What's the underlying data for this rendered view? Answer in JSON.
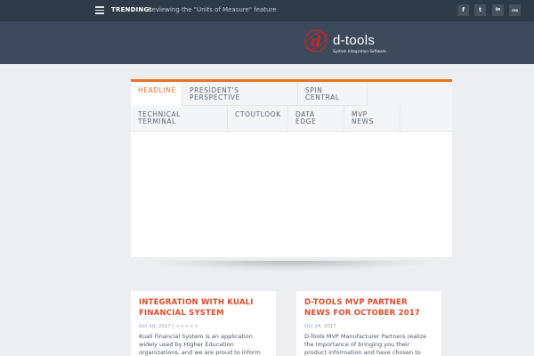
{
  "topbar": {
    "trending_label": "TRENDING:",
    "trending_text": "Reviewing the \"Units of Measure\" feature",
    "social": [
      {
        "name": "facebook",
        "glyph": "f"
      },
      {
        "name": "twitter",
        "glyph": "t"
      },
      {
        "name": "linkedin",
        "glyph": "in"
      },
      {
        "name": "rss",
        "glyph": "rss"
      }
    ]
  },
  "header": {
    "logo_text": "d-tools",
    "logo_sub": "System Integration Software",
    "logo_color": "#cf2027"
  },
  "tabs": [
    {
      "label": "HEADLINE",
      "active": true
    },
    {
      "label": "PRESIDENT'S PERSPECTIVE",
      "active": false
    },
    {
      "label": "SPIN CENTRAL",
      "active": false
    },
    {
      "label": "TECHNICAL TERMINAL",
      "active": false
    },
    {
      "label": "CTOUTLOOK",
      "active": false
    },
    {
      "label": "DATA EDGE",
      "active": false
    },
    {
      "label": "MVP NEWS",
      "active": false
    }
  ],
  "posts": [
    {
      "title": "INTEGRATION WITH KUALI FINANCIAL SYSTEM",
      "date": "Oct 30, 2017",
      "separator": "|",
      "excerpt": "Kuali Financial System is an application widely used by Higher Education organizations, and we are proud to inform an \"offline\" integration"
    },
    {
      "title": "D-TOOLS MVP PARTNER NEWS FOR OCTOBER 2017",
      "date": "Oct 24, 2017",
      "excerpt": "D-Tools MVP Manufacturer Partners realize the importance of bringing you their product information and have chosen to support the D-"
    }
  ],
  "colors": {
    "accent": "#e3742a",
    "title_red": "#d94e2a",
    "topbar": "#2f3a48",
    "header": "#3c4a5c"
  }
}
